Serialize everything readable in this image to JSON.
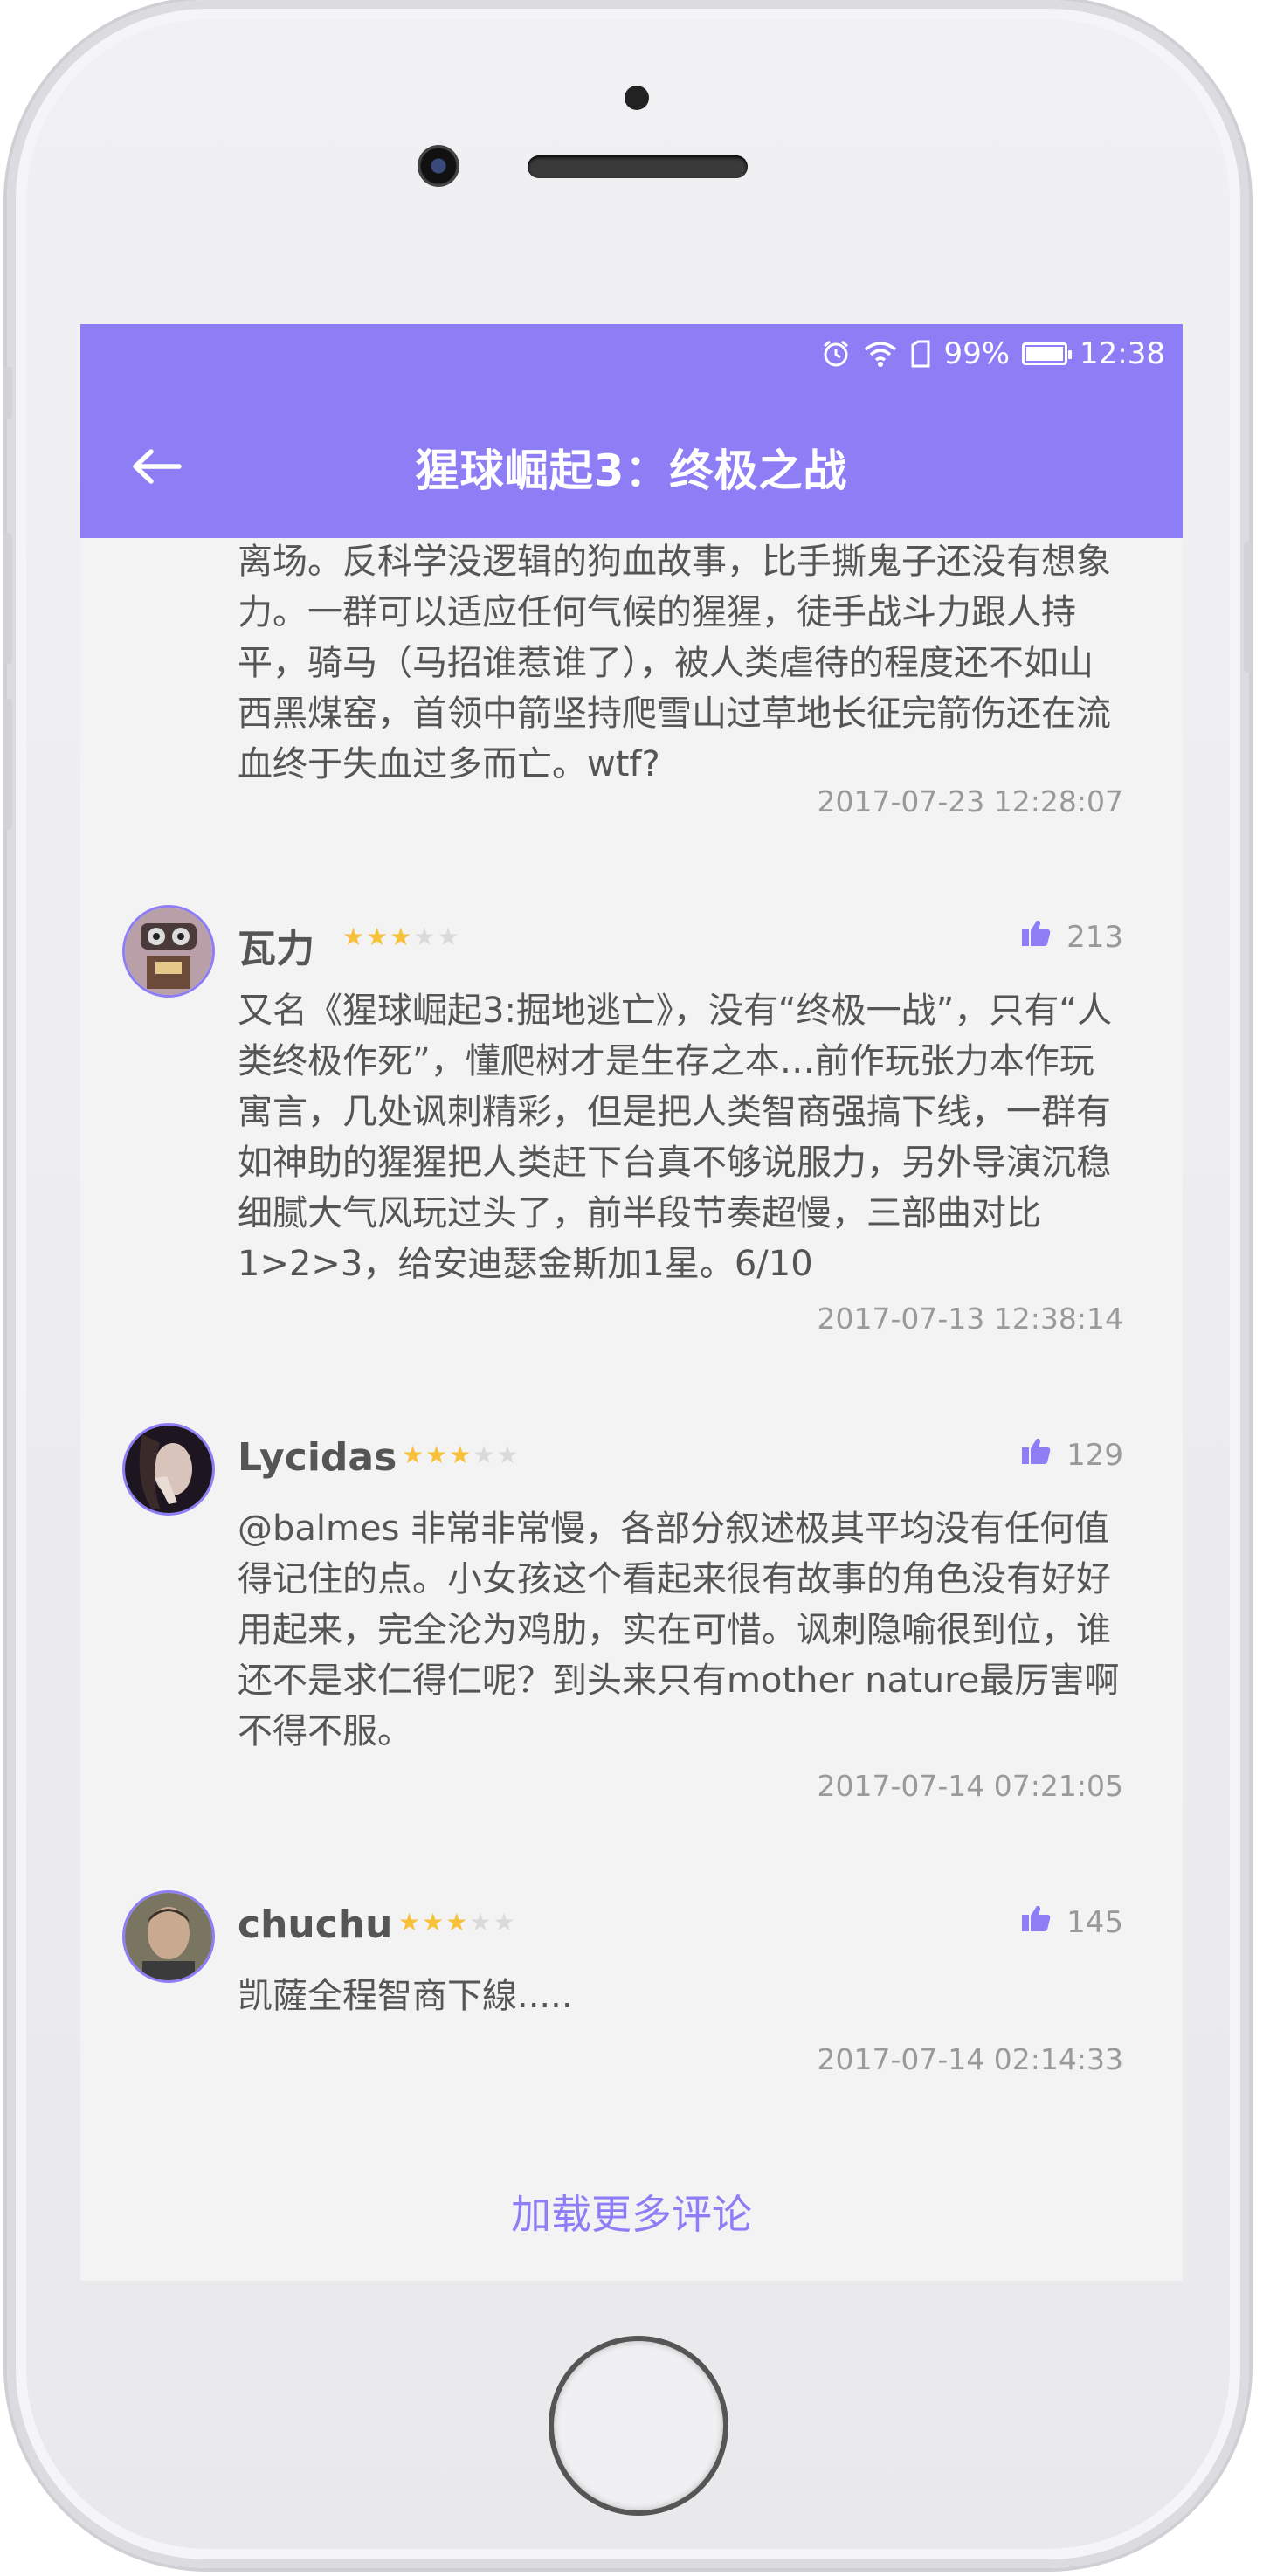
{
  "app": {
    "title": "猩球崛起3：终极之战",
    "accent_color": "#8d7ef5",
    "back_icon": "arrow-left-icon"
  },
  "status_bar": {
    "icons": [
      "alarm-icon",
      "wifi-icon",
      "sim-icon",
      "battery-icon"
    ],
    "battery_percent": "99%",
    "battery_level": 0.99,
    "time": "12:38"
  },
  "partial_review": {
    "text": "离场。反科学没逻辑的狗血故事，比手撕鬼子还没有想象力。一群可以适应任何气候的猩猩，徒手战斗力跟人持平，骑马（马招谁惹谁了），被人类虐待的程度还不如山西黑煤窑，首领中箭坚持爬雪山过草地长征完箭伤还在流血终于失血过多而亡。wtf?",
    "time": "2017-07-23 12:28:07"
  },
  "reviews": [
    {
      "name": "瓦力",
      "rating": 3,
      "max_rating": 5,
      "likes": "213",
      "text": "又名《猩球崛起3:掘地逃亡》，没有“终极一战”，只有“人类终极作死”，懂爬树才是生存之本…前作玩张力本作玩寓言，几处讽刺精彩，但是把人类智商强搞下线，一群有如神助的猩猩把人类赶下台真不够说服力，另外导演沉稳细腻大气风玩过头了，前半段节奏超慢，三部曲对比1>2>3，给安迪瑟金斯加1星。6/10",
      "time": "2017-07-13 12:38:14"
    },
    {
      "name": "Lycidas",
      "rating": 3,
      "max_rating": 5,
      "likes": "129",
      "text": "@balmes 非常非常慢，各部分叙述极其平均没有任何值得记住的点。小女孩这个看起来很有故事的角色没有好好用起来，完全沦为鸡肋，实在可惜。讽刺隐喻很到位，谁还不是求仁得仁呢？到头来只有mother nature最厉害啊不得不服。",
      "time": "2017-07-14 07:21:05"
    },
    {
      "name": "chuchu",
      "rating": 3,
      "max_rating": 5,
      "likes": "145",
      "text": "凯薩全程智商下線.....",
      "time": "2017-07-14 02:14:33"
    }
  ],
  "load_more": "加载更多评论"
}
